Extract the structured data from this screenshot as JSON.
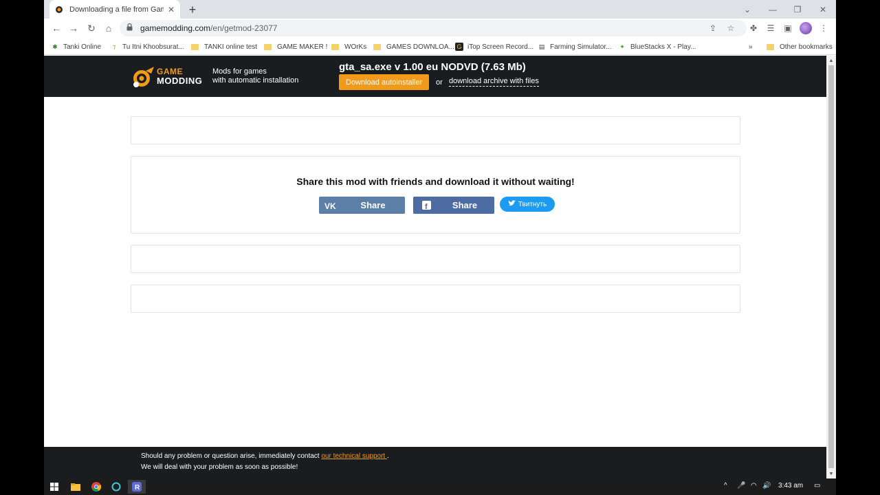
{
  "browser": {
    "tab_title": "Downloading a file from GameM",
    "url_host": "gamemodding.com",
    "url_path": "/en/getmod-23077",
    "bookmarks": [
      {
        "label": "Tanki Online"
      },
      {
        "label": "Tu Itni Khoobsurat..."
      },
      {
        "label": "TANKI online test"
      },
      {
        "label": "GAME MAKER !"
      },
      {
        "label": "WOrKs"
      },
      {
        "label": "GAMES DOWNLOA..."
      },
      {
        "label": "iTop Screen Record..."
      },
      {
        "label": "Farming Simulator..."
      },
      {
        "label": "BlueStacks X - Play..."
      }
    ],
    "more_bookmarks": "»",
    "other_bookmarks": "Other bookmarks"
  },
  "header": {
    "logo_line1": "GAME",
    "logo_line2": "MODDING",
    "tagline_1": "Mods for games",
    "tagline_2": "with automatic installation",
    "file_title": "gta_sa.exe v 1.00 eu NODVD (7.63 Mb)",
    "download_label": "Download autoinstaller",
    "or_label": "or",
    "archive_label": "download archive with files"
  },
  "share": {
    "title": "Share this mod with friends and download it without waiting!",
    "vk_label": "Share",
    "fb_label": "Share",
    "tw_label": "Твитнуть"
  },
  "footer": {
    "line1_prefix": "Should any problem or question arise, immediately contact ",
    "support_link": "our technical support ",
    "line1_suffix": ".",
    "line2": "We will deal with your problem as soon as possible!"
  },
  "taskbar": {
    "time": "3:43 am"
  }
}
